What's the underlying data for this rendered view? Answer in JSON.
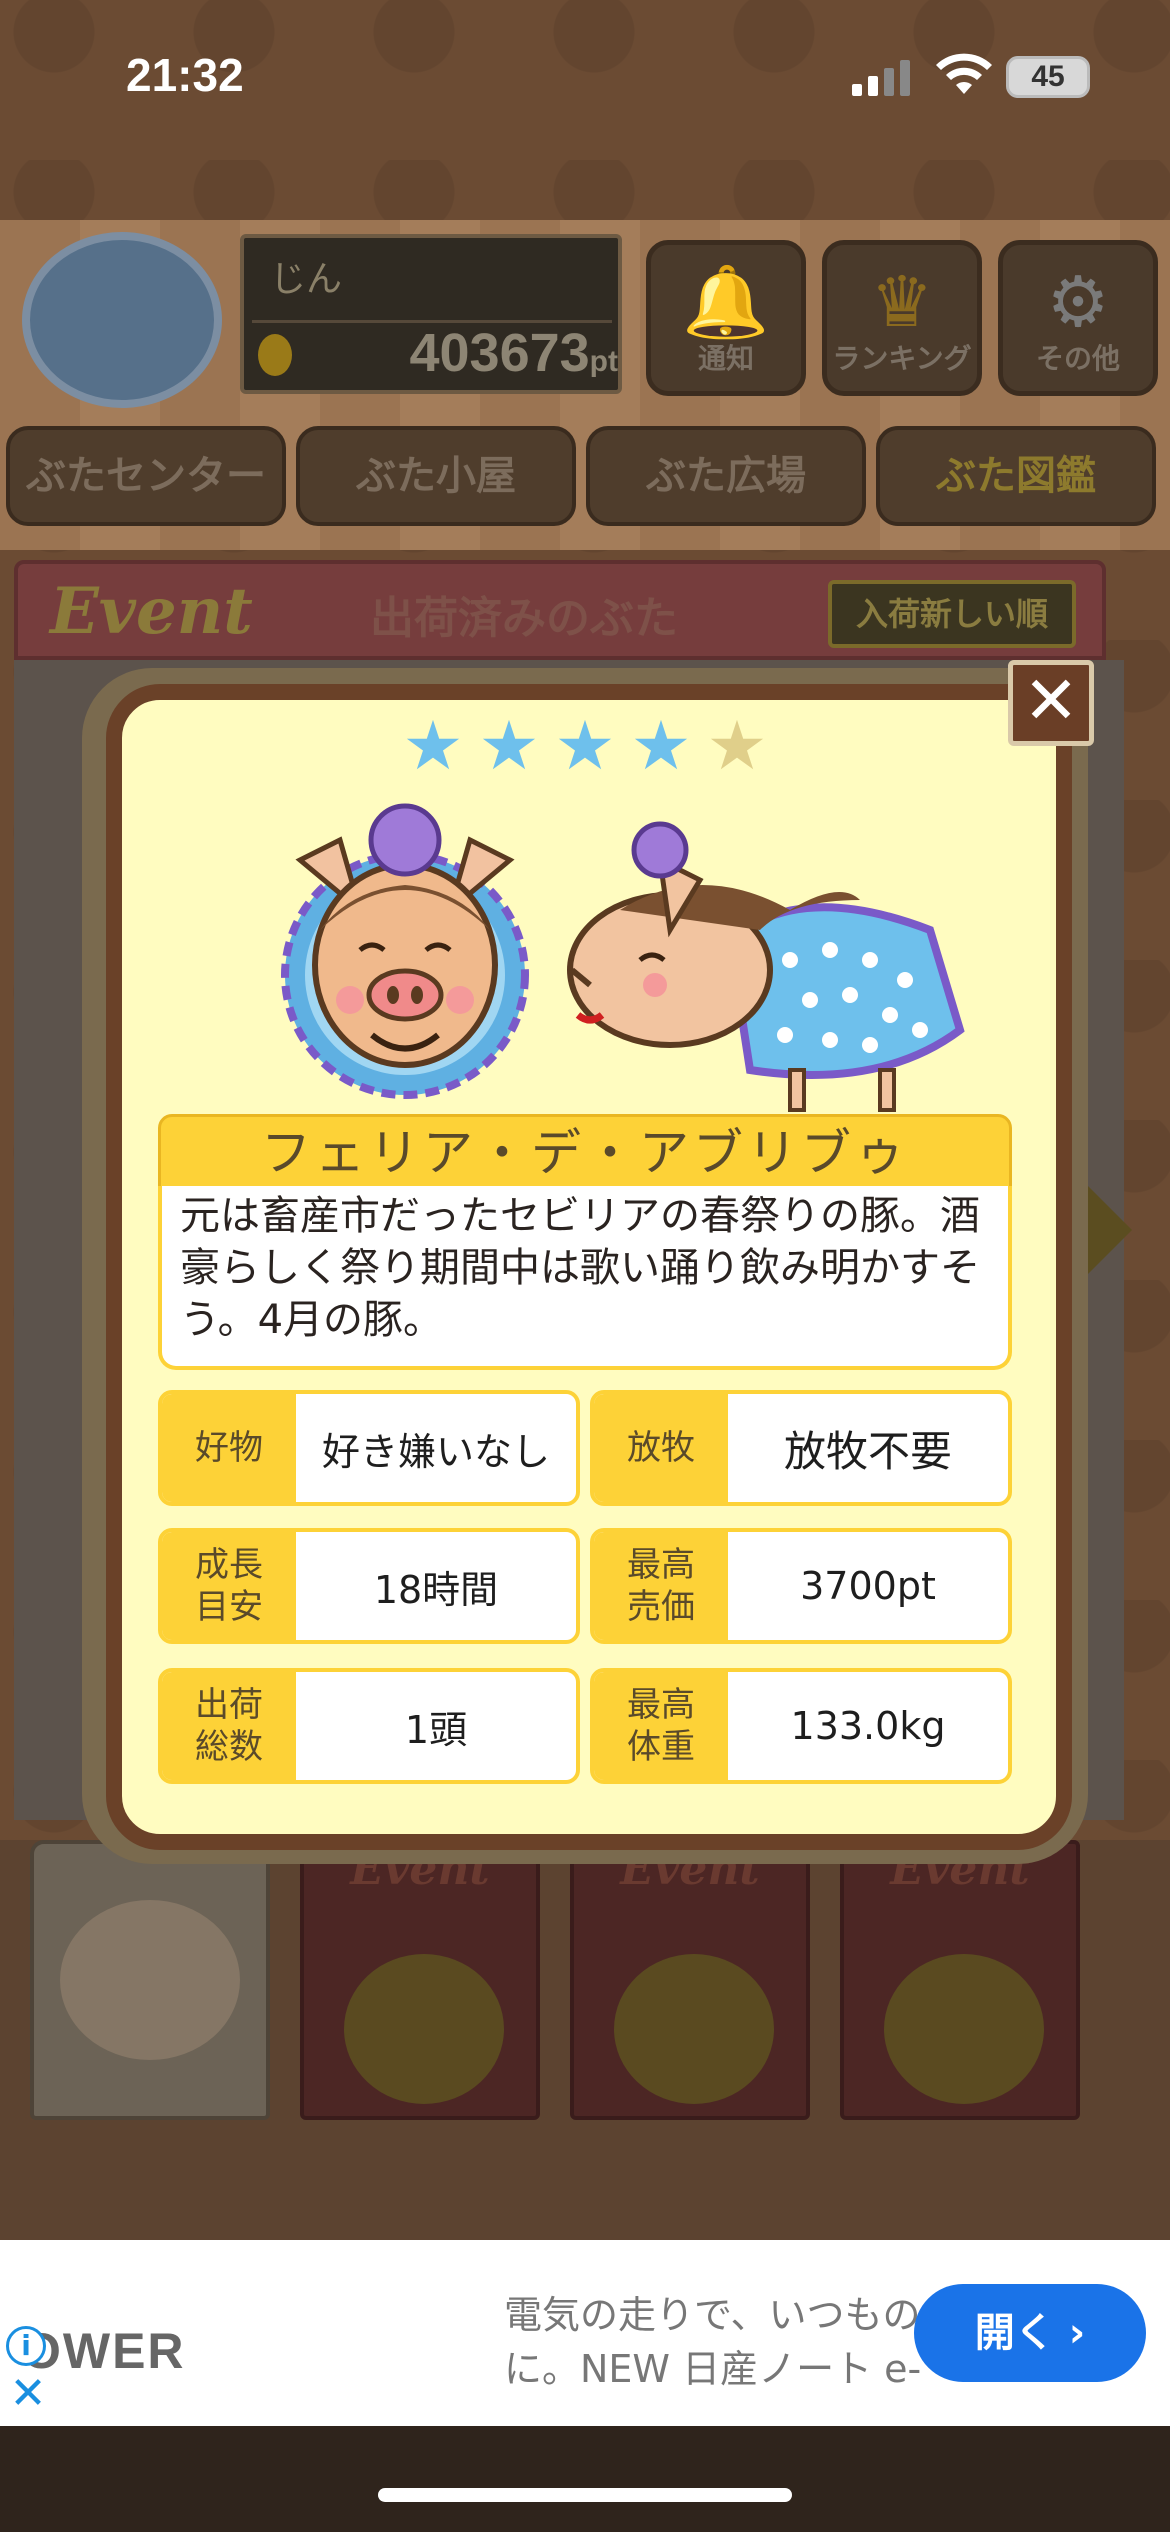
{
  "status_bar": {
    "time": "21:32",
    "battery": "45"
  },
  "header": {
    "user_name": "じん",
    "points": "403673",
    "points_unit": "pt",
    "buttons": [
      {
        "label": "通知",
        "icon": "bell-icon"
      },
      {
        "label": "ランキング",
        "icon": "crown-icon"
      },
      {
        "label": "その他",
        "icon": "gear-icon"
      }
    ]
  },
  "tabs": [
    "ぶたセンター",
    "ぶた小屋",
    "ぶた広場",
    "ぶた図鑑"
  ],
  "event_bar": {
    "logo": "Event",
    "title": "出荷済みのぶた",
    "sort_label": "入荷新しい順"
  },
  "bottom_books": [
    "Event",
    "Event",
    "Event"
  ],
  "modal": {
    "rating": 4,
    "rating_max": 5,
    "close_label": "✕",
    "pig_name": "フェリア・デ・アブリブゥ",
    "description": "元は畜産市だったセビリアの春祭りの豚。酒豪らしく祭り期間中は歌い踊り飲み明かすそう。4月の豚。",
    "stats": [
      {
        "label": "好物",
        "value": "好き嫌いなし"
      },
      {
        "label": "放牧",
        "value": "放牧不要"
      },
      {
        "label": "成長\n目安",
        "value": "18時間"
      },
      {
        "label": "最高\n売価",
        "value": "3700pt"
      },
      {
        "label": "出荷\n総数",
        "value": "1頭"
      },
      {
        "label": "最高\n体重",
        "value": "133.0kg"
      }
    ]
  },
  "ad": {
    "brand": "OWER",
    "copy_line1": "電気の走りで、いつもの",
    "copy_line2": "に。NEW 日産ノート e-",
    "open_label": "開く ›",
    "info_icon": "i"
  },
  "colors": {
    "modal_bg": "#fffcc0",
    "modal_border": "#6a4128",
    "label_yellow": "#fdd237",
    "star_on": "#6ec0ec",
    "star_off": "#e0cf8a",
    "ad_button": "#1a73e8"
  }
}
